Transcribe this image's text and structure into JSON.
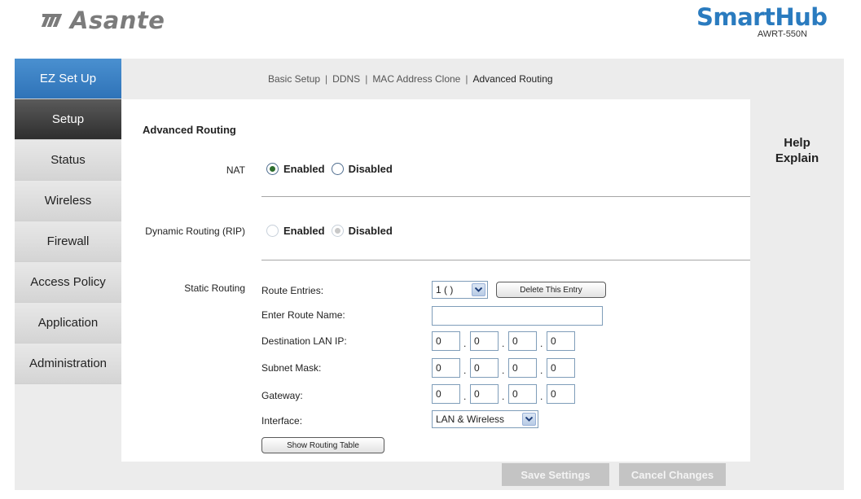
{
  "header": {
    "logo_text": "Asante",
    "brand_name": "SmartHub",
    "brand_model": "AWRT-550N"
  },
  "sidebar": {
    "items": [
      {
        "label": "EZ Set Up"
      },
      {
        "label": "Setup"
      },
      {
        "label": "Status"
      },
      {
        "label": "Wireless"
      },
      {
        "label": "Firewall"
      },
      {
        "label": "Access Policy"
      },
      {
        "label": "Application"
      },
      {
        "label": "Administration"
      }
    ]
  },
  "subnav": {
    "links": [
      "Basic Setup",
      "DDNS",
      "MAC Address Clone",
      "Advanced Routing"
    ],
    "separator": "|"
  },
  "content": {
    "section_title": "Advanced Routing",
    "nat": {
      "label": "NAT",
      "options": [
        "Enabled",
        "Disabled"
      ],
      "selected": "Enabled"
    },
    "rip": {
      "label": "Dynamic Routing (RIP)",
      "options": [
        "Enabled",
        "Disabled"
      ],
      "selected": "Disabled"
    },
    "static_routing": {
      "label": "Static Routing",
      "route_entries_label": "Route Entries:",
      "route_entries_value": "1 ( )",
      "delete_button": "Delete This Entry",
      "route_name_label": "Enter Route Name:",
      "route_name_value": "",
      "dest_ip_label": "Destination LAN IP:",
      "dest_ip": [
        "0",
        "0",
        "0",
        "0"
      ],
      "subnet_label": "Subnet Mask:",
      "subnet": [
        "0",
        "0",
        "0",
        "0"
      ],
      "gateway_label": "Gateway:",
      "gateway": [
        "0",
        "0",
        "0",
        "0"
      ],
      "interface_label": "Interface:",
      "interface_value": "LAN & Wireless",
      "show_table_button": "Show Routing Table"
    }
  },
  "help": {
    "line1": "Help",
    "line2": "Explain"
  },
  "actions": {
    "save": "Save Settings",
    "cancel": "Cancel Changes"
  },
  "colors": {
    "brand_blue": "#2a7bbf",
    "nav_active": "#3a3a3a",
    "nav_ez": "#3b82c6",
    "radio_dot": "#2e6e2e",
    "button_disabled": "#c4c4c4"
  },
  "icons": {
    "logo": "asante-logo-icon",
    "dropdown": "chevron-down-icon"
  }
}
